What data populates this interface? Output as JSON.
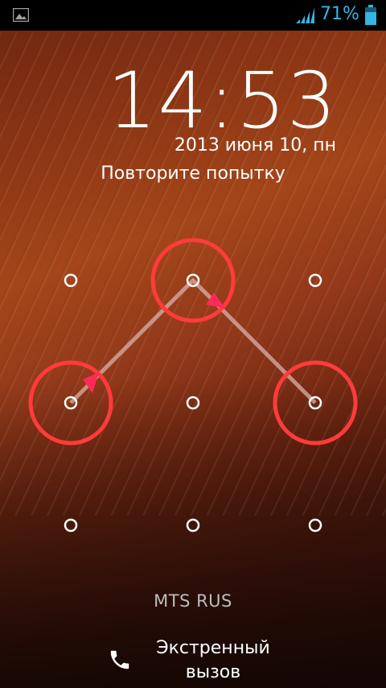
{
  "status_bar": {
    "battery_percent": "71%",
    "battery_level": 0.71,
    "accent_color": "#33b5e5",
    "icons": [
      "photo-icon",
      "signal-icon",
      "battery-icon"
    ]
  },
  "lockscreen": {
    "time": "14:53",
    "date": "2013 июня 10, пн",
    "prompt": "Повторите попытку",
    "pattern": {
      "grid": "3x3",
      "selected_dots": [
        "0-1",
        "1-0",
        "1-2"
      ],
      "path": [
        "1-0",
        "0-1",
        "1-2"
      ],
      "error_color": "#ff3b3b"
    },
    "carrier": "MTS RUS",
    "emergency_label_line1": "Экстренный",
    "emergency_label_line2": "вызов"
  }
}
